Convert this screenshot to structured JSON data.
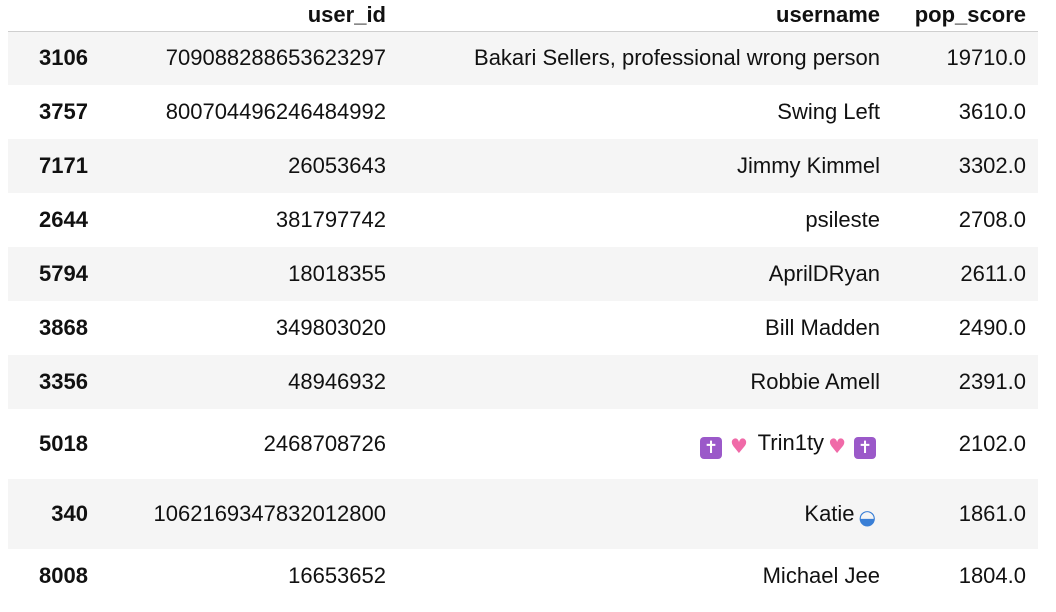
{
  "table": {
    "columns": [
      "",
      "user_id",
      "username",
      "pop_score"
    ],
    "rows": [
      {
        "index": "3106",
        "user_id": "709088288653623297",
        "username": "Bakari Sellers, professional wrong person",
        "pop_score": "19710.0"
      },
      {
        "index": "3757",
        "user_id": "800704496246484992",
        "username": "Swing Left",
        "pop_score": "3610.0"
      },
      {
        "index": "7171",
        "user_id": "26053643",
        "username": "Jimmy Kimmel",
        "pop_score": "3302.0"
      },
      {
        "index": "2644",
        "user_id": "381797742",
        "username": "psileste",
        "pop_score": "2708.0"
      },
      {
        "index": "5794",
        "user_id": "18018355",
        "username": "AprilDRyan",
        "pop_score": "2611.0"
      },
      {
        "index": "3868",
        "user_id": "349803020",
        "username": "Bill Madden",
        "pop_score": "2490.0"
      },
      {
        "index": "3356",
        "user_id": "48946932",
        "username": "Robbie Amell",
        "pop_score": "2391.0"
      },
      {
        "index": "5018",
        "user_id": "2468708726",
        "username_prefix_emoji": [
          "latin-cross-emoji",
          "sparkling-heart-emoji"
        ],
        "username": "Trin1ty",
        "username_suffix_emoji": [
          "sparkling-heart-emoji",
          "latin-cross-emoji"
        ],
        "pop_score": "2102.0"
      },
      {
        "index": "340",
        "user_id": "1062169347832012800",
        "username": "Katie",
        "username_suffix_emoji": [
          "billed-cap-emoji"
        ],
        "pop_score": "1861.0"
      },
      {
        "index": "8008",
        "user_id": "16653652",
        "username": "Michael Jee",
        "pop_score": "1804.0"
      }
    ]
  },
  "colors": {
    "stripe": "#f5f5f5",
    "header_rule": "#cfcfcf"
  }
}
